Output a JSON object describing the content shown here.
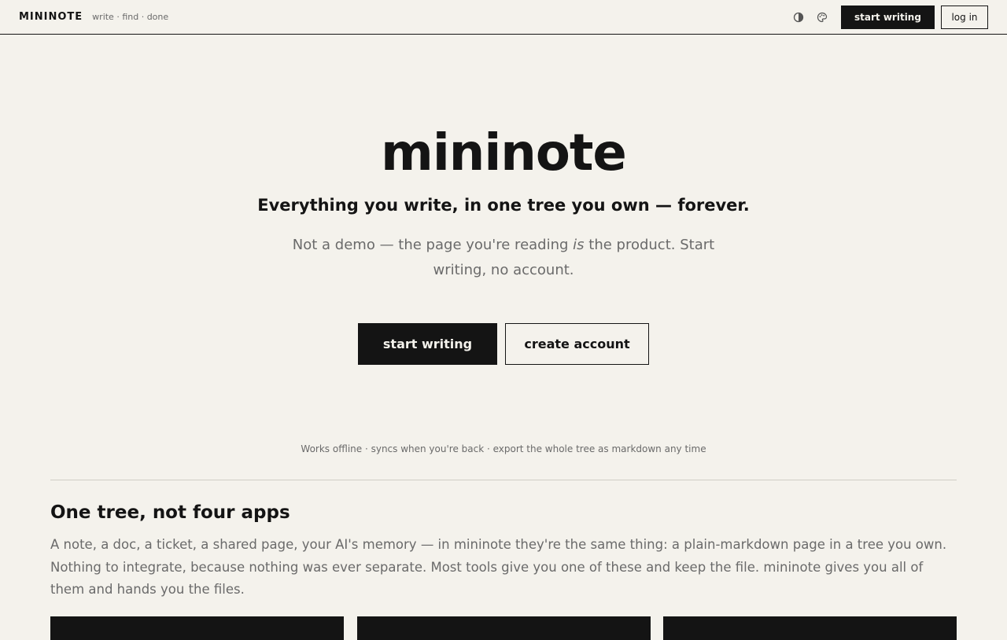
{
  "header": {
    "brand": "MININOTE",
    "tagline": "write · find · done",
    "theme_icon": "contrast-icon",
    "palette_icon": "palette-icon",
    "start_writing_label": "start writing",
    "login_label": "log in"
  },
  "hero": {
    "title": "mininote",
    "subtitle": "Everything you write, in one tree you own — forever.",
    "body_before": "Not a demo — the page you're reading ",
    "body_em": "is",
    "body_after": " the product. Start writing, no account.",
    "primary_cta": "start writing",
    "secondary_cta": "create account",
    "footnote": "Works offline · syncs when you're back · export the whole tree as markdown any time"
  },
  "section": {
    "title": "One tree, not four apps",
    "body": "A note, a doc, a ticket, a shared page, your AI's memory — in mininote they're the same thing: a plain-markdown page in a tree you own. Nothing to integrate, because nothing was ever separate. Most tools give you one of these and keep the file. mininote gives you all of them and hands you the files."
  },
  "colors": {
    "background": "#f4f2ec",
    "ink": "#141414",
    "muted": "#6a6a6a"
  }
}
